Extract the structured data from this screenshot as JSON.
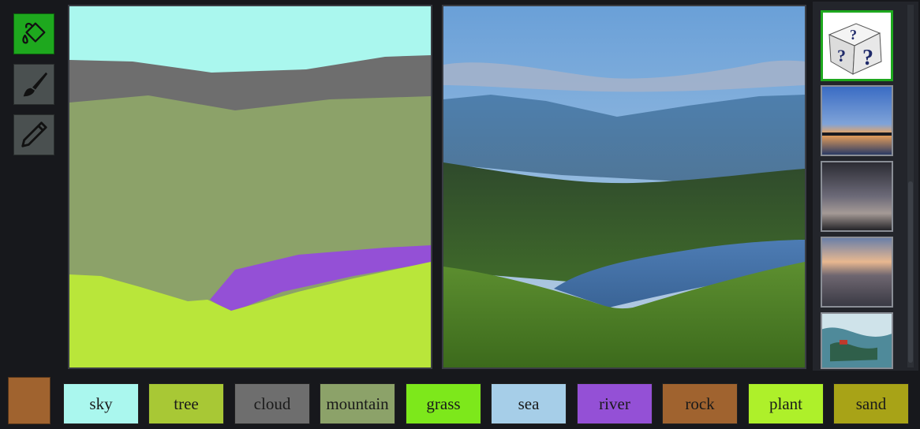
{
  "tools": [
    {
      "name": "paint-bucket",
      "icon": "paint-bucket-icon",
      "active": true
    },
    {
      "name": "brush",
      "icon": "brush-icon",
      "active": false
    },
    {
      "name": "pencil",
      "icon": "pencil-icon",
      "active": false
    }
  ],
  "current_color": "#a0632f",
  "palette": [
    {
      "label": "sky",
      "color": "#aaf7ee"
    },
    {
      "label": "tree",
      "color": "#a8c835"
    },
    {
      "label": "cloud",
      "color": "#6e6e6e"
    },
    {
      "label": "mountain",
      "color": "#8ca269"
    },
    {
      "label": "grass",
      "color": "#7de81b"
    },
    {
      "label": "sea",
      "color": "#a6cee8"
    },
    {
      "label": "river",
      "color": "#9450d6"
    },
    {
      "label": "rock",
      "color": "#a0632f"
    },
    {
      "label": "plant",
      "color": "#aef02a"
    },
    {
      "label": "sand",
      "color": "#a8a317"
    }
  ],
  "thumbnails": [
    {
      "name": "random-dice",
      "icon": "dice-icon",
      "selected": true
    },
    {
      "name": "style-sunset-lake",
      "selected": false
    },
    {
      "name": "style-dusk-clouds",
      "selected": false
    },
    {
      "name": "style-evening-city",
      "selected": false
    },
    {
      "name": "style-painting",
      "selected": false
    }
  ]
}
